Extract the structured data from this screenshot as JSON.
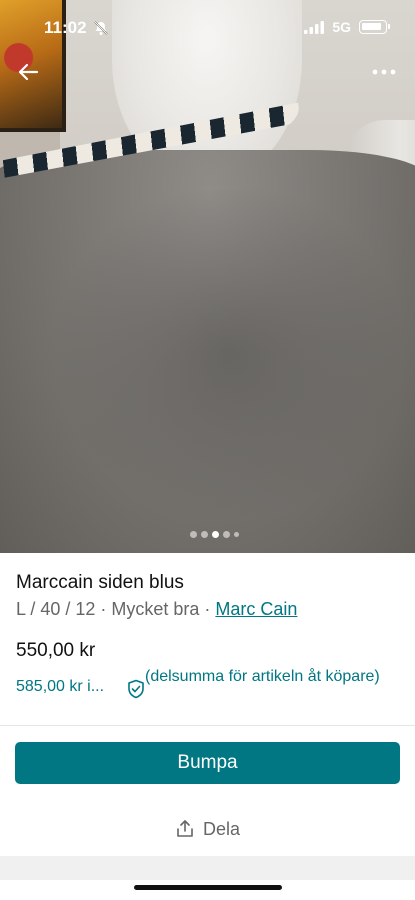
{
  "status_bar": {
    "time": "11:02",
    "network": "5G",
    "icons": [
      "bell-slash-icon",
      "signal-icon",
      "battery-icon"
    ]
  },
  "nav": {
    "back_icon": "arrow-left-icon",
    "more_icon": "more-horizontal-icon"
  },
  "gallery": {
    "image_description_icon": "product-photo",
    "page_count": 5,
    "active_index": 2
  },
  "listing": {
    "title": "Marccain siden blus",
    "meta_prefix": "L / 40 / 12 · Mycket bra · ",
    "brand": "Marc Cain",
    "price": "550,00 kr",
    "total_price": "585,00 kr i...",
    "total_note": "(delsumma för artikeln åt köpare)"
  },
  "actions": {
    "bump_label": "Bumpa",
    "share_label": "Dela"
  },
  "colors": {
    "accent": "#007782",
    "text_primary": "#111111",
    "text_secondary": "#666666"
  }
}
